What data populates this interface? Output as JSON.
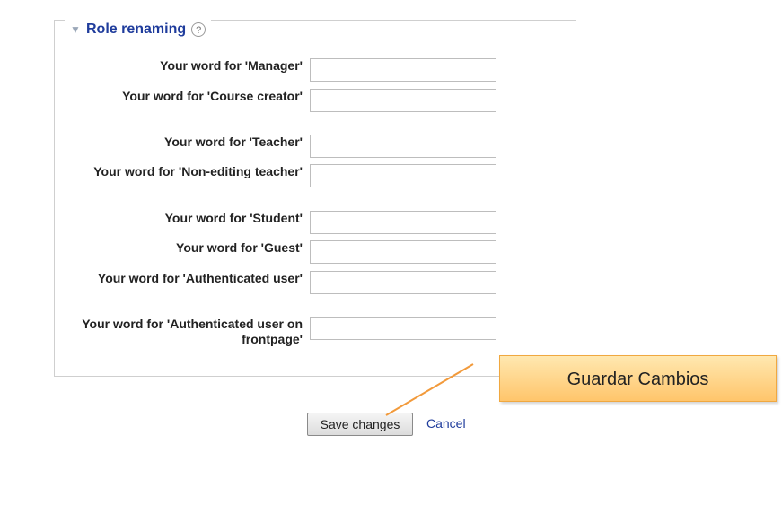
{
  "section": {
    "title": "Role renaming",
    "help_glyph": "?",
    "toggle_glyph": "▼",
    "fields": [
      {
        "label": "Your word for 'Manager'",
        "value": ""
      },
      {
        "label": "Your word for 'Course creator'",
        "value": ""
      },
      {
        "label": "Your word for 'Teacher'",
        "value": ""
      },
      {
        "label": "Your word for 'Non-editing teacher'",
        "value": ""
      },
      {
        "label": "Your word for 'Student'",
        "value": ""
      },
      {
        "label": "Your word for 'Guest'",
        "value": ""
      },
      {
        "label": "Your word for 'Authenticated user'",
        "value": ""
      },
      {
        "label": "Your word for 'Authenticated user on frontpage'",
        "value": ""
      }
    ]
  },
  "actions": {
    "save_label": "Save changes",
    "cancel_label": "Cancel"
  },
  "annotation": {
    "text": "Guardar  Cambios"
  },
  "colors": {
    "link": "#1f3c9c",
    "callout_fill": "#ffc56b",
    "callout_border": "#f0a840",
    "connector": "#f29a3b"
  }
}
